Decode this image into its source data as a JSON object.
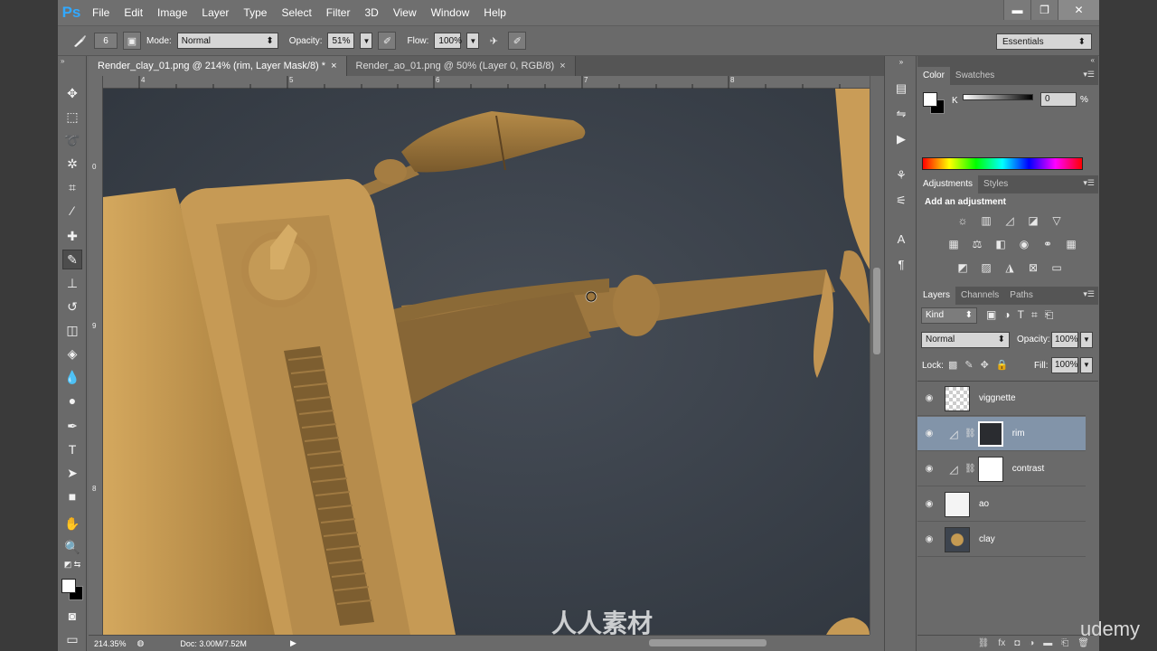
{
  "app": {
    "logo": "Ps"
  },
  "menu": [
    "File",
    "Edit",
    "Image",
    "Layer",
    "Type",
    "Select",
    "Filter",
    "3D",
    "View",
    "Window",
    "Help"
  ],
  "window_controls": {
    "minimize": "▬",
    "restore": "❐",
    "close": "✕"
  },
  "options": {
    "brush_size": "6",
    "mode_label": "Mode:",
    "mode_value": "Normal",
    "opacity_label": "Opacity:",
    "opacity_value": "51%",
    "flow_label": "Flow:",
    "flow_value": "100%",
    "workspace": "Essentials"
  },
  "doc_tabs": [
    {
      "label": "Render_clay_01.png @ 214% (rim, Layer Mask/8) *",
      "close": "×"
    },
    {
      "label": "Render_ao_01.png @ 50% (Layer 0, RGB/8)",
      "close": "×"
    }
  ],
  "ruler": {
    "top": [
      "4",
      "5",
      "6",
      "7",
      "8"
    ],
    "left": [
      "0",
      "9",
      "8"
    ]
  },
  "status": {
    "zoom": "214.35%",
    "doc": "Doc: 3.00M/7.52M"
  },
  "color_panel": {
    "tabs": [
      "Color",
      "Swatches"
    ],
    "channel": "K",
    "value": "0",
    "unit": "%"
  },
  "adjustments_panel": {
    "tabs": [
      "Adjustments",
      "Styles"
    ],
    "heading": "Add an adjustment"
  },
  "layers_panel": {
    "tabs": [
      "Layers",
      "Channels",
      "Paths"
    ],
    "filter": "Kind",
    "blend_mode": "Normal",
    "opacity_label": "Opacity:",
    "opacity_value": "100%",
    "lock_label": "Lock:",
    "fill_label": "Fill:",
    "fill_value": "100%",
    "layers": [
      {
        "name": "viggnette"
      },
      {
        "name": "rim"
      },
      {
        "name": "contrast"
      },
      {
        "name": "ao"
      },
      {
        "name": "clay"
      }
    ]
  },
  "watermark": {
    "brand": "udemy",
    "cn": "人人素材"
  },
  "colors": {
    "accent_ps": "#31a8ff",
    "selected_layer": "#8294a9",
    "canvas_bg": "#3d444e",
    "clay": "#c49a52"
  }
}
